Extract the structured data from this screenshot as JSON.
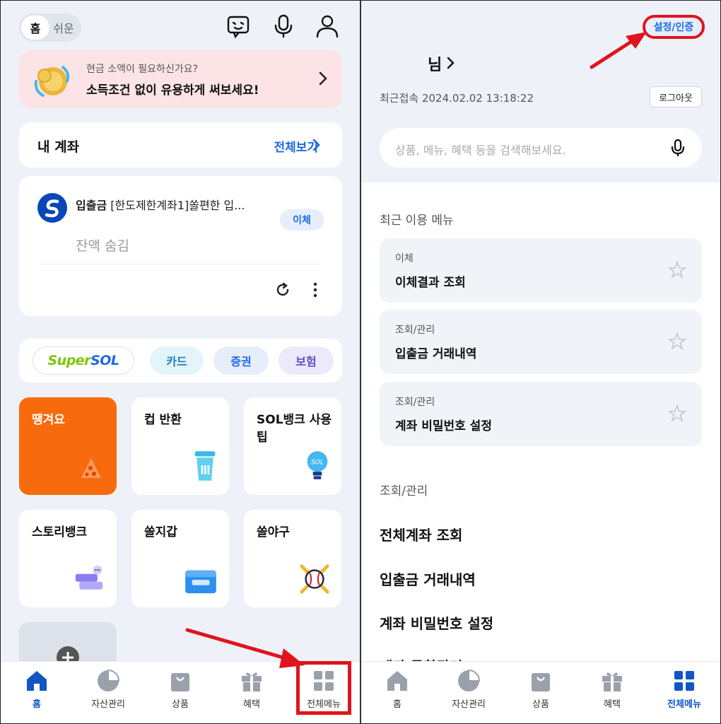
{
  "left": {
    "mode_toggle": {
      "active": "홈",
      "inactive": "쉬운"
    },
    "icons": [
      "chatbot-icon",
      "microphone-icon",
      "user-icon"
    ],
    "promo": {
      "line1": "현금 소액이 필요하신가요?",
      "line2": "소득조건 없이 유용하게 써보세요!"
    },
    "accounts": {
      "title": "내 계좌",
      "view_all": "전체보기"
    },
    "account_card": {
      "name_bold": "입출금",
      "name_rest": " [한도제한계좌1]쏠편한 입...",
      "transfer": "이체",
      "balance": "잔액 숨김"
    },
    "chips": {
      "supersol_a": "Super",
      "supersol_b": "SOL",
      "card": "카드",
      "stock": "증권",
      "insurance": "보험"
    },
    "tiles": [
      {
        "label": "땡겨요",
        "icon": "pizza-icon"
      },
      {
        "label": "컵 반환",
        "icon": "cup-icon"
      },
      {
        "label": "SOL뱅크 사용팁",
        "icon": "lightbulb-icon"
      },
      {
        "label": "스토리뱅크",
        "icon": "chat-bubbles-icon"
      },
      {
        "label": "쏠지갑",
        "icon": "wallet-icon"
      },
      {
        "label": "쏠야구",
        "icon": "baseball-icon"
      }
    ],
    "nav": [
      "홈",
      "자산관리",
      "상품",
      "혜택",
      "전체메뉴"
    ],
    "nav_active": "홈"
  },
  "right": {
    "settings": "설정/인증",
    "user_suffix": "님",
    "last_login": "최근접속 2024.02.02 13:18:22",
    "logout": "로그아웃",
    "search_placeholder": "상품, 메뉴, 혜택 등을 검색해보세요.",
    "recent_title": "최근 이용 메뉴",
    "recent": [
      {
        "category": "이체",
        "name": "이체결과 조회"
      },
      {
        "category": "조회/관리",
        "name": "입출금 거래내역"
      },
      {
        "category": "조회/관리",
        "name": "계좌 비밀번호 설정"
      }
    ],
    "section_title": "조회/관리",
    "menu": [
      "전체계좌 조회",
      "입출금 거래내역",
      "계좌 비밀번호 설정",
      "계좌 통합관리"
    ],
    "nav": [
      "홈",
      "자산관리",
      "상품",
      "혜택",
      "전체메뉴"
    ],
    "nav_active": "전체메뉴"
  },
  "colors": {
    "accent": "#1c6be0",
    "highlight": "#e0141e",
    "orange": "#f76b0e",
    "nav_active": "#1256c4"
  }
}
